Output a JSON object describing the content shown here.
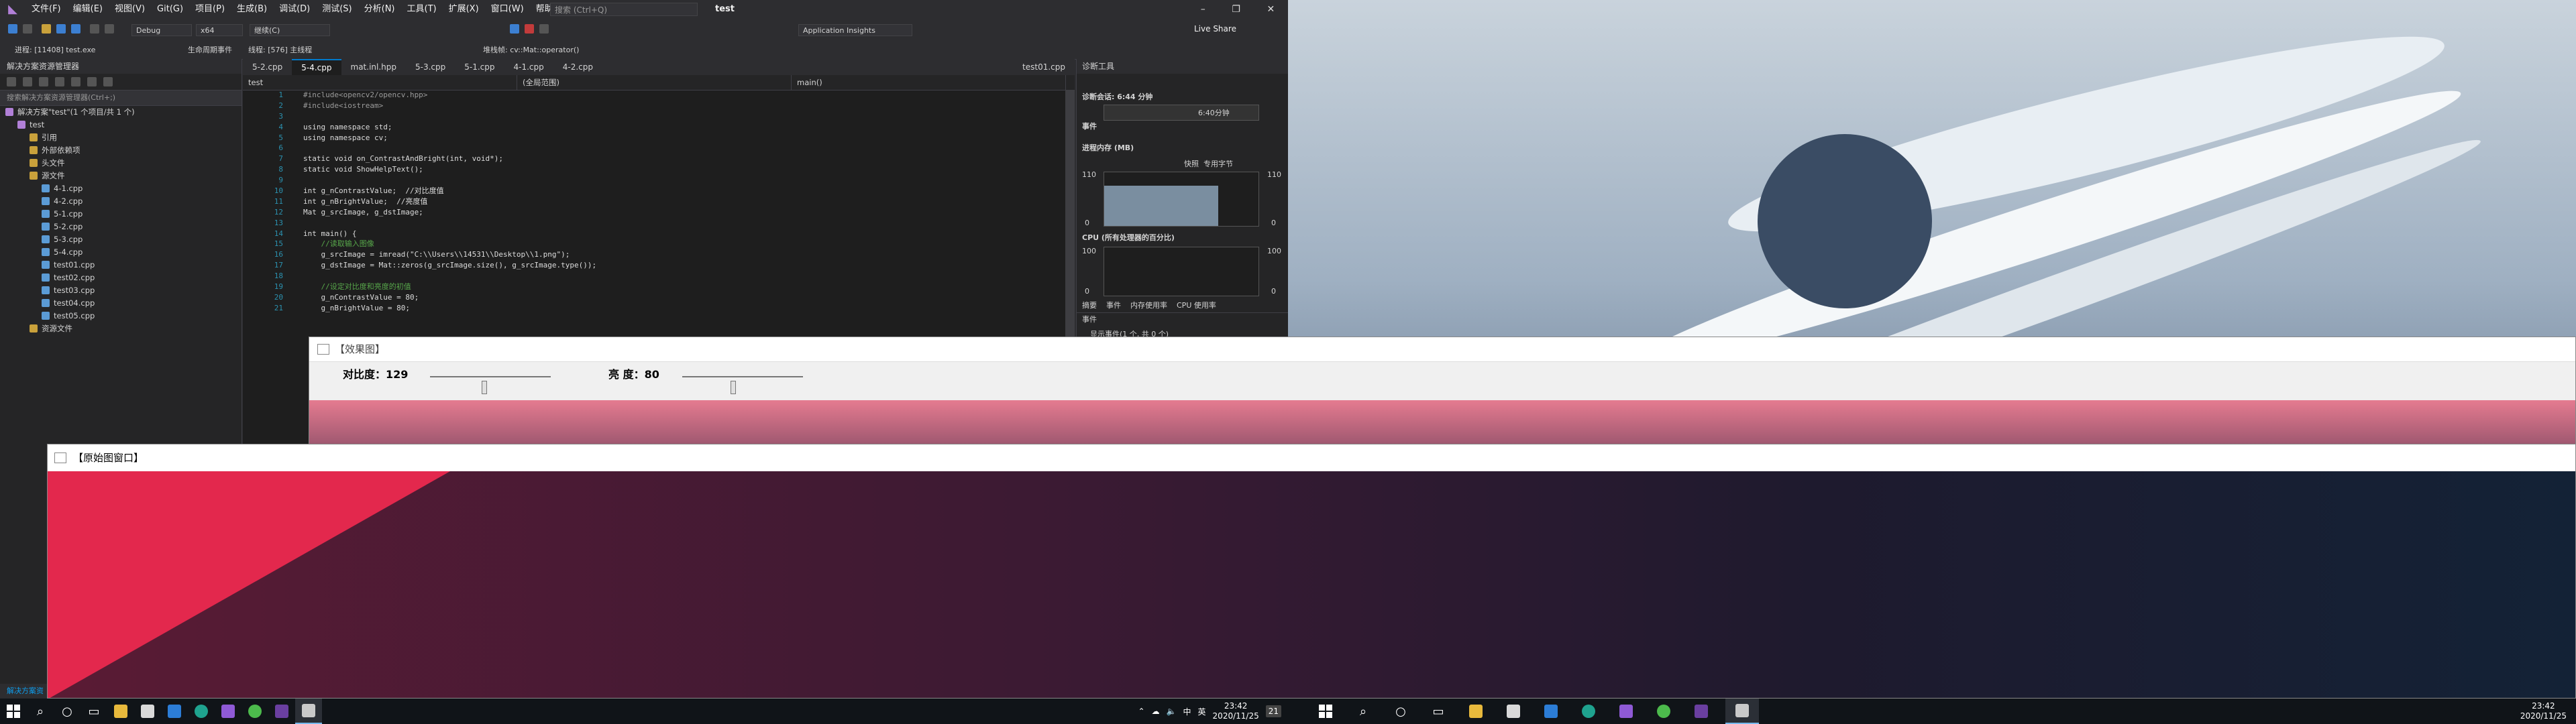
{
  "vs": {
    "menu": [
      "文件(F)",
      "编辑(E)",
      "视图(V)",
      "Git(G)",
      "项目(P)",
      "生成(B)",
      "调试(D)",
      "测试(S)",
      "分析(N)",
      "工具(T)",
      "扩展(X)",
      "窗口(W)",
      "帮助(H)"
    ],
    "search_placeholder": "搜索 (Ctrl+Q)",
    "title": "test",
    "live_share": "Live Share",
    "toolbar": {
      "config": "Debug",
      "platform": "x64",
      "continue": "继续(C)",
      "app_insights": "Application Insights"
    },
    "process_label": "进程: [11408] test.exe",
    "lifecycle": "生命周期事件",
    "thread_label": "线程: [576] 主线程",
    "stack_label": "堆栈帧: cv::Mat::operator()"
  },
  "solution": {
    "header": "解决方案资源管理器",
    "search_placeholder": "搜索解决方案资源管理器(Ctrl+;)",
    "items": [
      {
        "label": "解决方案\"test\"(1 个项目/共 1 个)",
        "indent": 0
      },
      {
        "label": "test",
        "indent": 1
      },
      {
        "label": "引用",
        "indent": 2
      },
      {
        "label": "外部依赖项",
        "indent": 2
      },
      {
        "label": "头文件",
        "indent": 2
      },
      {
        "label": "源文件",
        "indent": 2
      },
      {
        "label": "4-1.cpp",
        "indent": 3
      },
      {
        "label": "4-2.cpp",
        "indent": 3
      },
      {
        "label": "5-1.cpp",
        "indent": 3
      },
      {
        "label": "5-2.cpp",
        "indent": 3
      },
      {
        "label": "5-3.cpp",
        "indent": 3
      },
      {
        "label": "5-4.cpp",
        "indent": 3
      },
      {
        "label": "test01.cpp",
        "indent": 3
      },
      {
        "label": "test02.cpp",
        "indent": 3
      },
      {
        "label": "test03.cpp",
        "indent": 3
      },
      {
        "label": "test04.cpp",
        "indent": 3
      },
      {
        "label": "test05.cpp",
        "indent": 3
      },
      {
        "label": "资源文件",
        "indent": 2
      }
    ],
    "footer": "解决方案资"
  },
  "editor": {
    "tabs": [
      "5-2.cpp",
      "5-4.cpp",
      "mat.inl.hpp",
      "5-3.cpp",
      "5-1.cpp",
      "4-1.cpp",
      "4-2.cpp",
      "test01.cpp"
    ],
    "active_tab": "5-4.cpp",
    "nav": [
      "test",
      "(全局范围)",
      "main()"
    ],
    "lines": [
      "#include<opencv2/opencv.hpp>",
      "#include<iostream>",
      "",
      "using namespace std;",
      "using namespace cv;",
      "",
      "static void on_ContrastAndBright(int, void*);",
      "static void ShowHelpText();",
      "",
      "int g_nContrastValue;  //对比度值",
      "int g_nBrightValue;  //亮度值",
      "Mat g_srcImage, g_dstImage;",
      "",
      "int main() {",
      "    //读取输入图像",
      "    g_srcImage = imread(\"C:\\\\Users\\\\14531\\\\Desktop\\\\1.png\");",
      "    g_dstImage = Mat::zeros(g_srcImage.size(), g_srcImage.type());",
      "",
      "    //设定对比度和亮度的初值",
      "    g_nContrastValue = 80;",
      "    g_nBrightValue = 80;"
    ]
  },
  "diag": {
    "header": "诊断工具",
    "session": "诊断会话: 6:44 分钟",
    "time_marker": "6:40分钟",
    "events": "事件",
    "memory": "进程内存 (MB)",
    "snapshot": "快照",
    "private_bytes": "专用字节",
    "mem_max": "110",
    "mem_min": "0",
    "cpu": "CPU (所有处理器的百分比)",
    "cpu_max": "100",
    "cpu_min": "0",
    "tabs": [
      "摘要",
      "事件",
      "内存使用率",
      "CPU 使用率"
    ],
    "events2": "事件",
    "all_events": "显示事件(1 个, 共 0 个)"
  },
  "effect_window": {
    "title": "【效果图】",
    "contrast_label": "对比度：129",
    "contrast_value": 129,
    "contrast_max": 300,
    "bright_label": "亮  度：80",
    "bright_value": 80,
    "bright_max": 200
  },
  "original_window": {
    "title": "【原始图窗口】"
  },
  "taskbar_left": {
    "time": "23:42",
    "date": "2020/11/25",
    "notif": "21",
    "lang": "中",
    "ime": "英"
  },
  "taskbar_right": {
    "time": "23:42",
    "date": "2020/11/25"
  }
}
